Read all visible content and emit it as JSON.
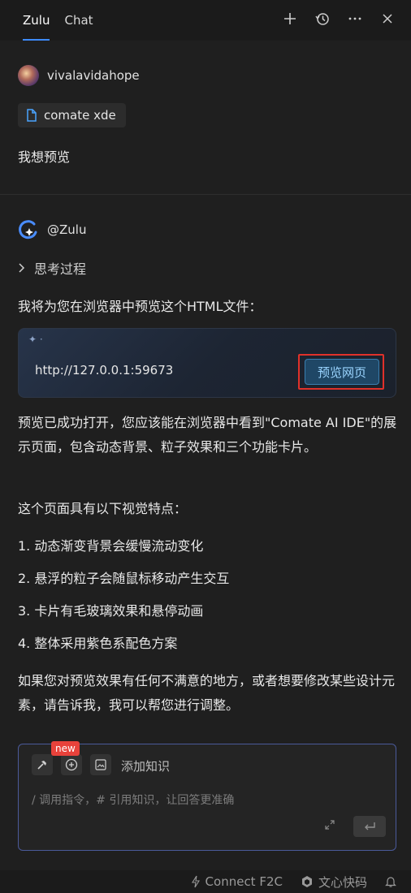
{
  "header": {
    "tabs": [
      {
        "label": "Zulu",
        "active": true
      },
      {
        "label": "Chat",
        "active": false
      }
    ],
    "actions": [
      "plus-icon",
      "history-icon",
      "more-icon",
      "close-icon"
    ]
  },
  "user_message": {
    "username": "vivalavidahope",
    "attachment": "comate xde",
    "text": "我想预览"
  },
  "assistant": {
    "name": "@Zulu",
    "thinking_label": "思考过程",
    "intro": "我将为您在浏览器中预览这个HTML文件：",
    "preview": {
      "url": "http://127.0.0.1:59673",
      "button_label": "预览网页"
    },
    "result": "预览已成功打开，您应该能在浏览器中看到\"Comate AI IDE\"的展示页面，包含动态背景、粒子效果和三个功能卡片。",
    "features_intro": "这个页面具有以下视觉特点：",
    "features": [
      "1. 动态渐变背景会缓慢流动变化",
      "2. 悬浮的粒子会随鼠标移动产生交互",
      "3. 卡片有毛玻璃效果和悬停动画",
      "4. 整体采用紫色系配色方案"
    ],
    "closing": "如果您对预览效果有任何不满意的地方，或者想要修改某些设计元素，请告诉我，我可以帮您进行调整。"
  },
  "composer": {
    "new_badge": "new",
    "add_knowledge": "添加知识",
    "placeholder": "/ 调用指令，# 引用知识，让回答更准确"
  },
  "statusbar": {
    "connect": "Connect F2C",
    "brand": "文心快码"
  },
  "colors": {
    "accent": "#3d8bff",
    "highlight_border": "#e0312a",
    "badge": "#e8423b"
  }
}
